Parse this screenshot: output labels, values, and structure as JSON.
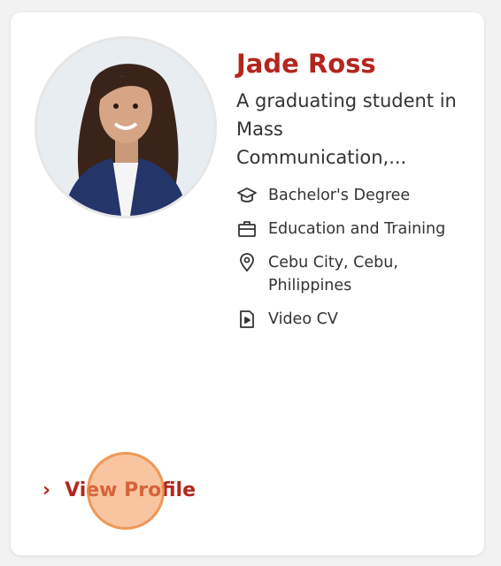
{
  "profile": {
    "name": "Jade Ross",
    "bio": "A graduating student in Mass Communication,...",
    "details": [
      {
        "icon": "graduation-cap-icon",
        "text": "Bachelor's Degree"
      },
      {
        "icon": "briefcase-icon",
        "text": "Education and Training"
      },
      {
        "icon": "location-pin-icon",
        "text": "Cebu City, Cebu, Philippines"
      },
      {
        "icon": "video-file-icon",
        "text": "Video CV"
      }
    ],
    "action_label": "View Profile",
    "accent_color": "#b3261e"
  }
}
